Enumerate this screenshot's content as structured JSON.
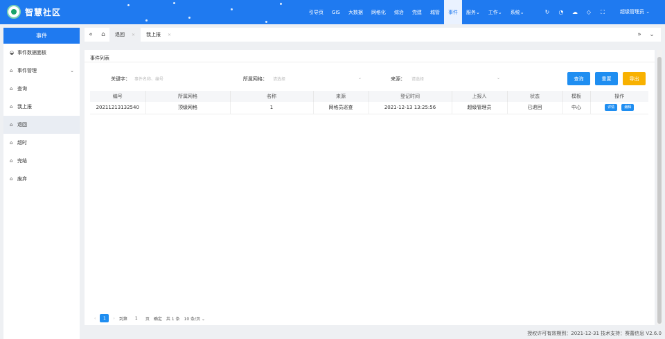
{
  "app": {
    "name": "智慧社区"
  },
  "topnav": {
    "items": [
      "引导页",
      "GIS",
      "大数据",
      "网格化",
      "综治",
      "党建",
      "城管",
      "事件",
      "服务",
      "工作",
      "系统"
    ],
    "active_index": 7,
    "user": "超级管理员"
  },
  "sidebar": {
    "header": "事件",
    "items": [
      {
        "label": "事件数据面板",
        "icon": "dashboard-icon"
      },
      {
        "label": "事件管理",
        "icon": "home-icon",
        "expandable": true
      },
      {
        "label": "查询",
        "icon": "home-icon"
      },
      {
        "label": "我上报",
        "icon": "home-icon"
      },
      {
        "label": "退回",
        "icon": "home-icon",
        "active": true
      },
      {
        "label": "超时",
        "icon": "home-icon"
      },
      {
        "label": "完结",
        "icon": "home-icon"
      },
      {
        "label": "废弃",
        "icon": "home-icon"
      }
    ]
  },
  "tabs": [
    {
      "label": "退回",
      "active": true
    },
    {
      "label": "我上报",
      "active": false
    }
  ],
  "main": {
    "title": "事件列表",
    "filters": {
      "keyword": {
        "label": "关键字：",
        "placeholder": "事件名称、编号"
      },
      "grid": {
        "label": "所属网格：",
        "placeholder": "请选择"
      },
      "source": {
        "label": "来源：",
        "placeholder": "请选择"
      }
    },
    "buttons": {
      "query": "查询",
      "reset": "重置",
      "export": "导出"
    },
    "table": {
      "columns": [
        "编号",
        "所属网格",
        "名称",
        "来源",
        "登记时间",
        "上报人",
        "状态",
        "模板",
        "操作"
      ],
      "rows": [
        {
          "id": "20211213132540",
          "grid": "顶级网格",
          "name": "1",
          "source": "网格员巡查",
          "time": "2021-12-13 13:25:56",
          "reporter": "超级管理员",
          "status": "已退回",
          "template": "中心",
          "actions": [
            "详情",
            "编辑"
          ]
        }
      ]
    },
    "pagination": {
      "current": "1",
      "goto_label": "到第",
      "goto_value": "1",
      "page_unit": "页",
      "confirm": "确定",
      "total": "共 1 条",
      "page_size": "10 条/页"
    }
  },
  "footer": {
    "text": "授权许可有效期到：2021-12-31  技术支持：赛蕾信息  V2.6.0"
  },
  "colors": {
    "primary": "#1f7af0",
    "button_blue": "#1f8ef1",
    "button_orange": "#f8b100"
  }
}
